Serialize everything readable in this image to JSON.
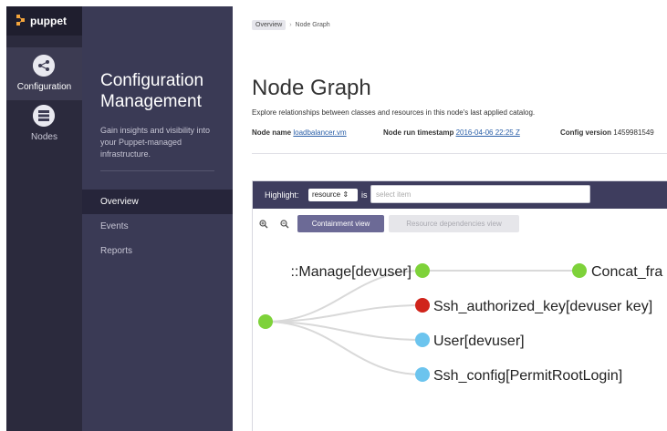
{
  "brand": {
    "name": "puppet",
    "accent": "#f4a53c"
  },
  "rail": {
    "items": [
      {
        "label": "Configuration",
        "icon": "configuration-icon",
        "active": true
      },
      {
        "label": "Nodes",
        "icon": "nodes-icon",
        "active": false
      }
    ]
  },
  "section": {
    "title": "Configuration Management",
    "description": "Gain insights and visibility into your Puppet-managed infrastructure.",
    "nav": [
      {
        "label": "Overview",
        "active": true
      },
      {
        "label": "Events",
        "active": false
      },
      {
        "label": "Reports",
        "active": false
      }
    ]
  },
  "breadcrumb": {
    "root": "Overview",
    "separator": "›",
    "current": "Node Graph"
  },
  "page": {
    "title": "Node Graph",
    "subtitle": "Explore relationships between classes and resources in this node's last applied catalog.",
    "node_name_label": "Node name",
    "node_name_value": "loadbalancer.vm",
    "timestamp_label": "Node run timestamp",
    "timestamp_value": "2016-04-06 22:25 Z",
    "config_version_label": "Config version",
    "config_version_value": "1459981549"
  },
  "toolbar": {
    "highlight_label": "Highlight:",
    "highlight_select": "resource ⇕",
    "is_label": "is",
    "search_placeholder": "select item"
  },
  "view": {
    "zoom_in": "zoom-in-icon",
    "zoom_out": "zoom-out-icon",
    "containment_label": "Containment view",
    "dependencies_label": "Resource dependencies view"
  },
  "graph": {
    "nodes": [
      {
        "label": "",
        "color": "#7ed23a"
      },
      {
        "label": "::Manage[devuser]",
        "color": "#7ed23a"
      },
      {
        "label": "Concat_fra",
        "color": "#7ed23a"
      },
      {
        "label": "Ssh_authorized_key[devuser key]",
        "color": "#d0241b"
      },
      {
        "label": "User[devuser]",
        "color": "#6cc4ee"
      },
      {
        "label": "Ssh_config[PermitRootLogin]",
        "color": "#6cc4ee"
      }
    ],
    "edge_color": "#d9d9d9"
  }
}
